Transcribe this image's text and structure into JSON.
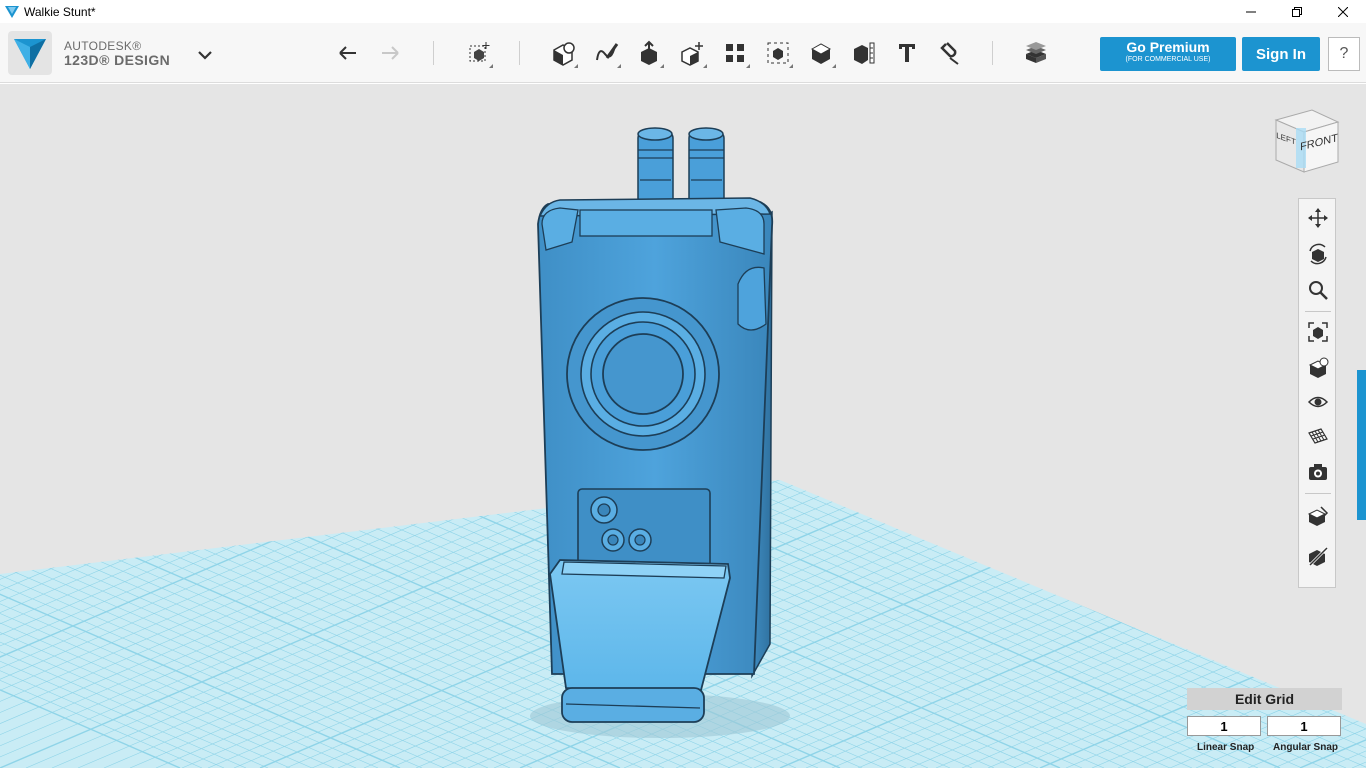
{
  "window": {
    "title": "Walkie Stunt*"
  },
  "brand": {
    "line1": "AUTODESK®",
    "line2": "123D® DESIGN"
  },
  "toolbar": {
    "tools": [
      {
        "name": "undo",
        "icon": "undo-icon"
      },
      {
        "name": "redo",
        "icon": "redo-icon"
      },
      {
        "name": "transform",
        "icon": "transform-icon"
      },
      {
        "name": "primitives",
        "icon": "primitives-icon"
      },
      {
        "name": "sketch",
        "icon": "sketch-icon"
      },
      {
        "name": "construct",
        "icon": "construct-icon"
      },
      {
        "name": "modify",
        "icon": "modify-icon"
      },
      {
        "name": "pattern",
        "icon": "pattern-icon"
      },
      {
        "name": "group",
        "icon": "group-icon"
      },
      {
        "name": "combine",
        "icon": "combine-icon"
      },
      {
        "name": "measure",
        "icon": "measure-icon"
      },
      {
        "name": "text",
        "icon": "text-icon"
      },
      {
        "name": "snap",
        "icon": "snap-icon"
      },
      {
        "name": "material",
        "icon": "material-icon"
      }
    ],
    "premium_label": "Go Premium",
    "premium_sub": "(FOR COMMERCIAL USE)",
    "signin_label": "Sign In",
    "help_label": "?"
  },
  "viewcube": {
    "front": "FRONT",
    "left": "LEFT"
  },
  "navbar": [
    "pan-icon",
    "orbit-icon",
    "zoom-icon",
    "fit-icon",
    "views-icon",
    "visibility-icon",
    "grid-view-icon",
    "screenshot-icon",
    "material-view-icon",
    "hide-icon"
  ],
  "grid": {
    "edit_label": "Edit Grid",
    "linear_snap_value": "1",
    "angular_snap_value": "1",
    "linear_snap_label": "Linear Snap",
    "angular_snap_label": "Angular Snap"
  },
  "colors": {
    "model": "#4a9fd9",
    "model_dark": "#2e6e9a",
    "grid_line": "#8fd4e8",
    "grid_bg": "#c9ecf5",
    "accent": "#1c94d0",
    "viewport_bg": "#e5e5e5"
  }
}
